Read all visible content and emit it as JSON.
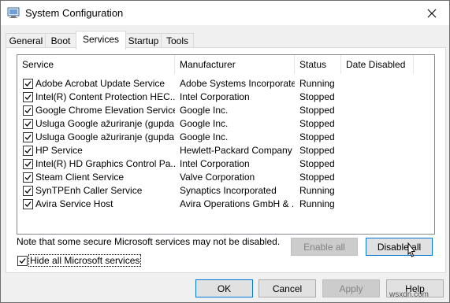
{
  "window": {
    "title": "System Configuration"
  },
  "tabs": [
    {
      "label": "General",
      "active": false
    },
    {
      "label": "Boot",
      "active": false
    },
    {
      "label": "Services",
      "active": true
    },
    {
      "label": "Startup",
      "active": false
    },
    {
      "label": "Tools",
      "active": false
    }
  ],
  "columns": {
    "service": "Service",
    "manufacturer": "Manufacturer",
    "status": "Status",
    "date_disabled": "Date Disabled"
  },
  "services": [
    {
      "name": "Adobe Acrobat Update Service",
      "manufacturer": "Adobe Systems Incorporated",
      "status": "Running",
      "checked": true
    },
    {
      "name": "Intel(R) Content Protection HEC...",
      "manufacturer": "Intel Corporation",
      "status": "Stopped",
      "checked": true
    },
    {
      "name": "Google Chrome Elevation Service",
      "manufacturer": "Google Inc.",
      "status": "Stopped",
      "checked": true
    },
    {
      "name": "Usluga Google ažuriranje (gupda...",
      "manufacturer": "Google Inc.",
      "status": "Stopped",
      "checked": true
    },
    {
      "name": "Usluga Google ažuriranje (gupda...",
      "manufacturer": "Google Inc.",
      "status": "Stopped",
      "checked": true
    },
    {
      "name": "HP Service",
      "manufacturer": "Hewlett-Packard Company",
      "status": "Stopped",
      "checked": true
    },
    {
      "name": "Intel(R) HD Graphics Control Pa...",
      "manufacturer": "Intel Corporation",
      "status": "Stopped",
      "checked": true
    },
    {
      "name": "Steam Client Service",
      "manufacturer": "Valve Corporation",
      "status": "Stopped",
      "checked": true
    },
    {
      "name": "SynTPEnh Caller Service",
      "manufacturer": "Synaptics Incorporated",
      "status": "Running",
      "checked": true
    },
    {
      "name": "Avira Service Host",
      "manufacturer": "Avira Operations GmbH & ...",
      "status": "Running",
      "checked": true
    }
  ],
  "note": "Note that some secure Microsoft services may not be disabled.",
  "buttons": {
    "enable_all": "Enable all",
    "disable_all": "Disable all",
    "ok": "OK",
    "cancel": "Cancel",
    "apply": "Apply",
    "help": "Help"
  },
  "hide_ms": {
    "label": "Hide all Microsoft services",
    "checked": true
  },
  "watermark": "wsxdn.com",
  "icons": {
    "app": "system-config-icon",
    "close": "close-icon",
    "checkbox": "checkmark-icon",
    "cursor": "mouse-pointer-icon"
  }
}
